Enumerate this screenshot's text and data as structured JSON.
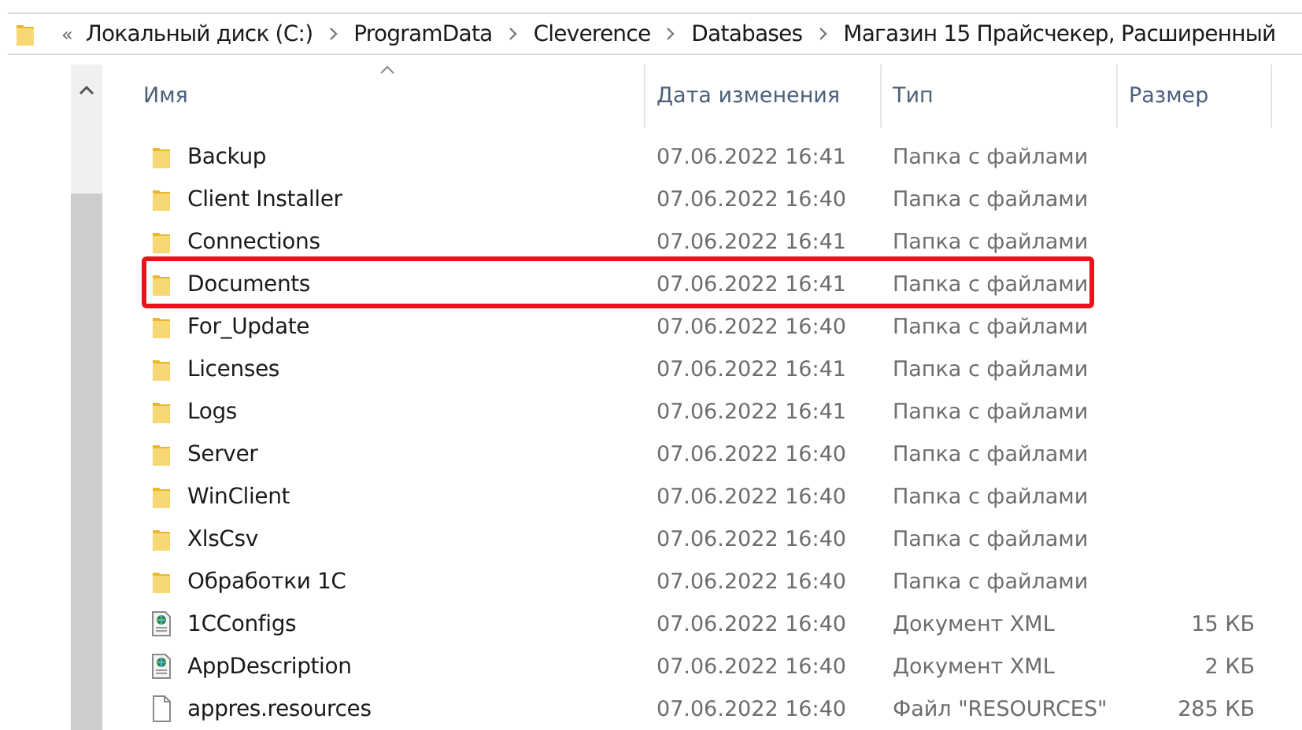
{
  "breadcrumb": {
    "overflow": "«",
    "items": [
      "Локальный диск (C:)",
      "ProgramData",
      "Cleverence",
      "Databases",
      "Магазин 15 Прайсчекер, Расширенный"
    ]
  },
  "columns": [
    {
      "label": "Имя",
      "sorted": true
    },
    {
      "label": "Дата изменения",
      "sorted": false
    },
    {
      "label": "Тип",
      "sorted": false
    },
    {
      "label": "Размер",
      "sorted": false
    }
  ],
  "rows": [
    {
      "kind": "folder",
      "name": "Backup",
      "date": "07.06.2022 16:41",
      "type": "Папка с файлами",
      "highlighted": false
    },
    {
      "kind": "folder",
      "name": "Client Installer",
      "date": "07.06.2022 16:40",
      "type": "Папка с файлами",
      "highlighted": false
    },
    {
      "kind": "folder",
      "name": "Connections",
      "date": "07.06.2022 16:41",
      "type": "Папка с файлами",
      "highlighted": false
    },
    {
      "kind": "folder",
      "name": "Documents",
      "date": "07.06.2022 16:41",
      "type": "Папка с файлами",
      "highlighted": true
    },
    {
      "kind": "folder",
      "name": "For_Update",
      "date": "07.06.2022 16:40",
      "type": "Папка с файлами",
      "highlighted": false
    },
    {
      "kind": "folder",
      "name": "Licenses",
      "date": "07.06.2022 16:41",
      "type": "Папка с файлами",
      "highlighted": false
    },
    {
      "kind": "folder",
      "name": "Logs",
      "date": "07.06.2022 16:41",
      "type": "Папка с файлами",
      "highlighted": false
    },
    {
      "kind": "folder",
      "name": "Server",
      "date": "07.06.2022 16:40",
      "type": "Папка с файлами",
      "highlighted": false
    },
    {
      "kind": "folder",
      "name": "WinClient",
      "date": "07.06.2022 16:40",
      "type": "Папка с файлами",
      "highlighted": false
    },
    {
      "kind": "folder",
      "name": "XlsCsv",
      "date": "07.06.2022 16:40",
      "type": "Папка с файлами",
      "highlighted": false
    },
    {
      "kind": "folder",
      "name": "Обработки 1С",
      "date": "07.06.2022 16:40",
      "type": "Папка с файлами",
      "highlighted": false
    },
    {
      "kind": "xml",
      "name": "1CConfigs",
      "date": "07.06.2022 16:40",
      "type": "Документ XML",
      "size": "15 КБ",
      "highlighted": false
    },
    {
      "kind": "xml",
      "name": "AppDescription",
      "date": "07.06.2022 16:40",
      "type": "Документ XML",
      "size": "2 КБ",
      "highlighted": false
    },
    {
      "kind": "file",
      "name": "appres.resources",
      "date": "07.06.2022 16:40",
      "type": "Файл \"RESOURCES\"",
      "size": "285 КБ",
      "highlighted": false
    }
  ]
}
